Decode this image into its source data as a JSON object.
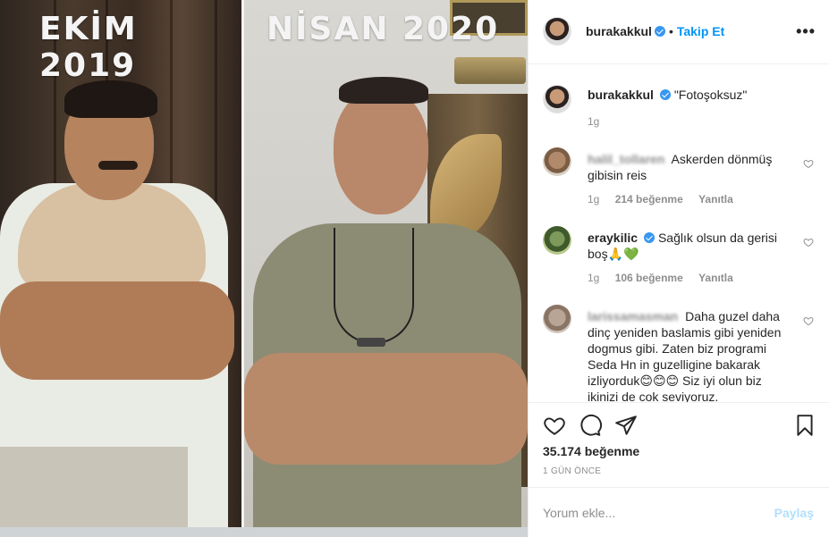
{
  "photo": {
    "left_caption": "EKİM 2019",
    "right_caption": "NİSAN 2020"
  },
  "header": {
    "username": "burakakkul",
    "separator": "•",
    "follow_label": "Takip Et",
    "more_icon": "more-horizontal-icon"
  },
  "caption": {
    "username": "burakakkul",
    "text": "\"Fotoşoksuz\"",
    "time": "1g"
  },
  "comments": [
    {
      "username": "halil_tollaren",
      "text": "Askerden dönmüş gibisin reis",
      "time": "1g",
      "likes": "214 beğenme",
      "reply": "Yanıtla"
    },
    {
      "username": "eraykilic",
      "text": "Sağlık olsun da gerisi boş🙏💚",
      "time": "1g",
      "likes": "106 beğenme",
      "reply": "Yanıtla"
    },
    {
      "username": "larissamasman",
      "text": "Daha guzel daha dinç yeniden baslamis gibi yeniden dogmus gibi. Zaten biz programi Seda Hn in guzelligine bakarak izliyorduk😊😊😊 Siz iyi olun biz ikinizi de cok seviyoruz."
    }
  ],
  "actions": {
    "likes": "35.174 beğenme",
    "posted": "1 GÜN ÖNCE"
  },
  "add_comment": {
    "placeholder": "Yorum ekle...",
    "post_label": "Paylaş"
  },
  "colors": {
    "accent": "#0095f6",
    "verified": "#3897f0",
    "muted": "#8e8e8e",
    "post_disabled": "#b2dffc"
  }
}
